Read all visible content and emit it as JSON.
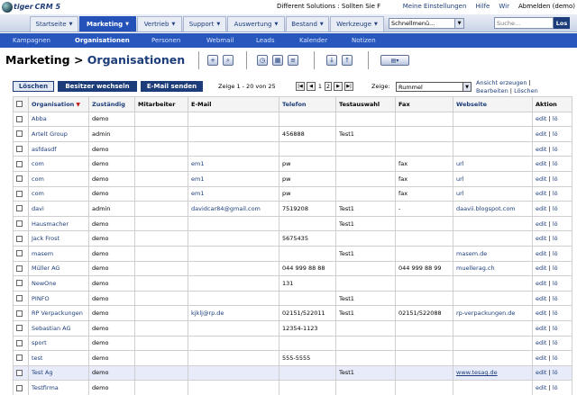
{
  "app": {
    "logo_brand": "tiger",
    "logo_text": "CRM 5",
    "top_message": "Different Solutions : Sollten Sie F",
    "top_links": [
      "Meine Einstellungen",
      "Hilfe",
      "Wir",
      "Abmelden (demo)"
    ]
  },
  "mainnav": {
    "tabs": [
      {
        "label": "Startseite",
        "caret": "▼"
      },
      {
        "label": "Marketing",
        "caret": "▼"
      },
      {
        "label": "Vertrieb",
        "caret": "▼"
      },
      {
        "label": "Support",
        "caret": "▼"
      },
      {
        "label": "Auswertung",
        "caret": "▼"
      },
      {
        "label": "Bestand",
        "caret": "▼"
      },
      {
        "label": "Werkzeuge",
        "caret": "▼"
      }
    ],
    "quickmenu": "Schnellmenü...",
    "search_placeholder": "Suche...",
    "search_button": "Los"
  },
  "subnav": [
    "Kampagnen",
    "Organisationen",
    "Personen",
    "Webmail",
    "Leads",
    "Kalender",
    "Notizen"
  ],
  "header": {
    "module": "Marketing >",
    "page": "Organisationen"
  },
  "actions": {
    "delete": "Löschen",
    "change_owner": "Besitzer wechseln",
    "send_email": "E-Mail senden",
    "page_info": "Zeige 1 - 20 von 25",
    "page_current": "1",
    "page_next": "2",
    "show_label": "Zeige:",
    "view_selected": "Rummel",
    "view_link_create": "Ansicht erzeugen",
    "view_link_edit": "Bearbeiten",
    "view_link_delete": "Löschen",
    "view_sep": "|"
  },
  "table": {
    "headers": [
      "Organisation",
      "Zuständig",
      "Mitarbeiter",
      "E-Mail",
      "Telefon",
      "Testauswahl",
      "Fax",
      "Webseite",
      "Aktion"
    ],
    "sort_arrow": "▼",
    "action_edit": "edit",
    "action_sep": "|",
    "action_delete": "lö",
    "rows": [
      [
        "Abba",
        "demo",
        "",
        "",
        "",
        "",
        "",
        ""
      ],
      [
        "Artelt Group",
        "admin",
        "",
        "",
        "456888",
        "Test1",
        "",
        ""
      ],
      [
        "asfdasdf",
        "demo",
        "",
        "",
        "",
        "",
        "",
        ""
      ],
      [
        "com",
        "demo",
        "",
        "em1",
        "pw",
        "",
        "fax",
        "url"
      ],
      [
        "com",
        "demo",
        "",
        "em1",
        "pw",
        "",
        "fax",
        "url"
      ],
      [
        "com",
        "demo",
        "",
        "em1",
        "pw",
        "",
        "fax",
        "url"
      ],
      [
        "davi",
        "admin",
        "",
        "davidcar84@gmail.com",
        "7519208",
        "Test1",
        "-",
        "daavii.blogspot.com"
      ],
      [
        "Hausmacher",
        "demo",
        "",
        "",
        "",
        "Test1",
        "",
        ""
      ],
      [
        "Jack Frost",
        "demo",
        "",
        "",
        "5675435",
        "",
        "",
        ""
      ],
      [
        "masem",
        "demo",
        "",
        "",
        "",
        "Test1",
        "",
        "masem.de"
      ],
      [
        "Müller AG",
        "demo",
        "",
        "",
        "044 999 88 88",
        "",
        "044 999 88 99",
        "muellerag.ch"
      ],
      [
        "NewOne",
        "demo",
        "",
        "",
        "131",
        "",
        "",
        ""
      ],
      [
        "PINFO",
        "demo",
        "",
        "",
        "",
        "Test1",
        "",
        ""
      ],
      [
        "RP Verpackungen",
        "demo",
        "",
        "kjklj@rp.de",
        "02151/522011",
        "Test1",
        "02151/522088",
        "rp-verpackungen.de"
      ],
      [
        "Sebastian AG",
        "demo",
        "",
        "",
        "12354-1123",
        "",
        "",
        ""
      ],
      [
        "sport",
        "demo",
        "",
        "",
        "",
        "",
        "",
        ""
      ],
      [
        "test",
        "demo",
        "",
        "",
        "555-5555",
        "",
        "",
        ""
      ],
      [
        "Test Ag",
        "demo",
        "",
        "",
        "",
        "Test1",
        "",
        "www.tesag.de"
      ],
      [
        "Testfirma",
        "demo",
        "",
        "",
        "",
        "",
        "",
        ""
      ]
    ]
  }
}
